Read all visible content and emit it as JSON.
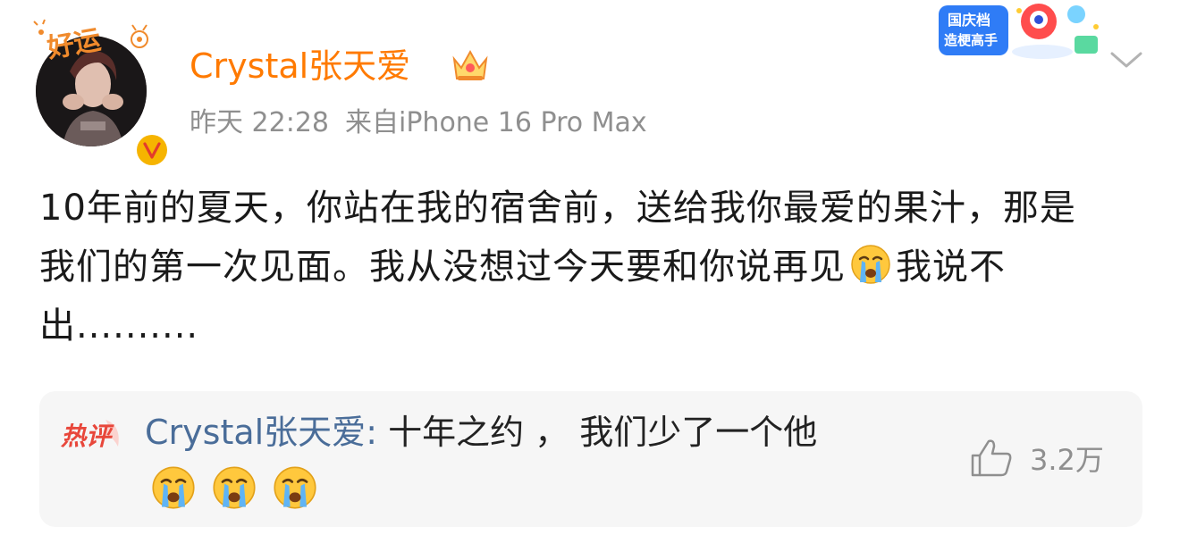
{
  "post": {
    "author": "Crystal张天爱",
    "time": "昨天 22:28",
    "source": "来自iPhone 16 Pro Max",
    "text_part1": "10年前的夏天，你站在我的宿舍前，送给我你最爱的果汁，那是我们的第一次见面。我从没想过今天要和你说再见",
    "text_part2": "我说不出..........",
    "avatar_deco_text": "好运"
  },
  "promo": {
    "line1": "国庆档",
    "line2": "造梗高手"
  },
  "hot_comment": {
    "label": "热评",
    "author": "Crystal张天爱",
    "colon": ":",
    "text": " 十年之约 ，  我们少了一个他",
    "like_count": "3.2万"
  },
  "colors": {
    "username": "#ff7a00",
    "meta": "#8f8f8f",
    "comment_author": "#4a6d99",
    "hot_label": "#e8473b",
    "comment_bg": "#f6f6f6"
  },
  "icons": {
    "crown": "crown-icon",
    "verified": "verified-badge-icon",
    "chevron": "chevron-down-icon",
    "emoji": "crying-emoji-icon",
    "like": "thumbs-up-icon"
  }
}
